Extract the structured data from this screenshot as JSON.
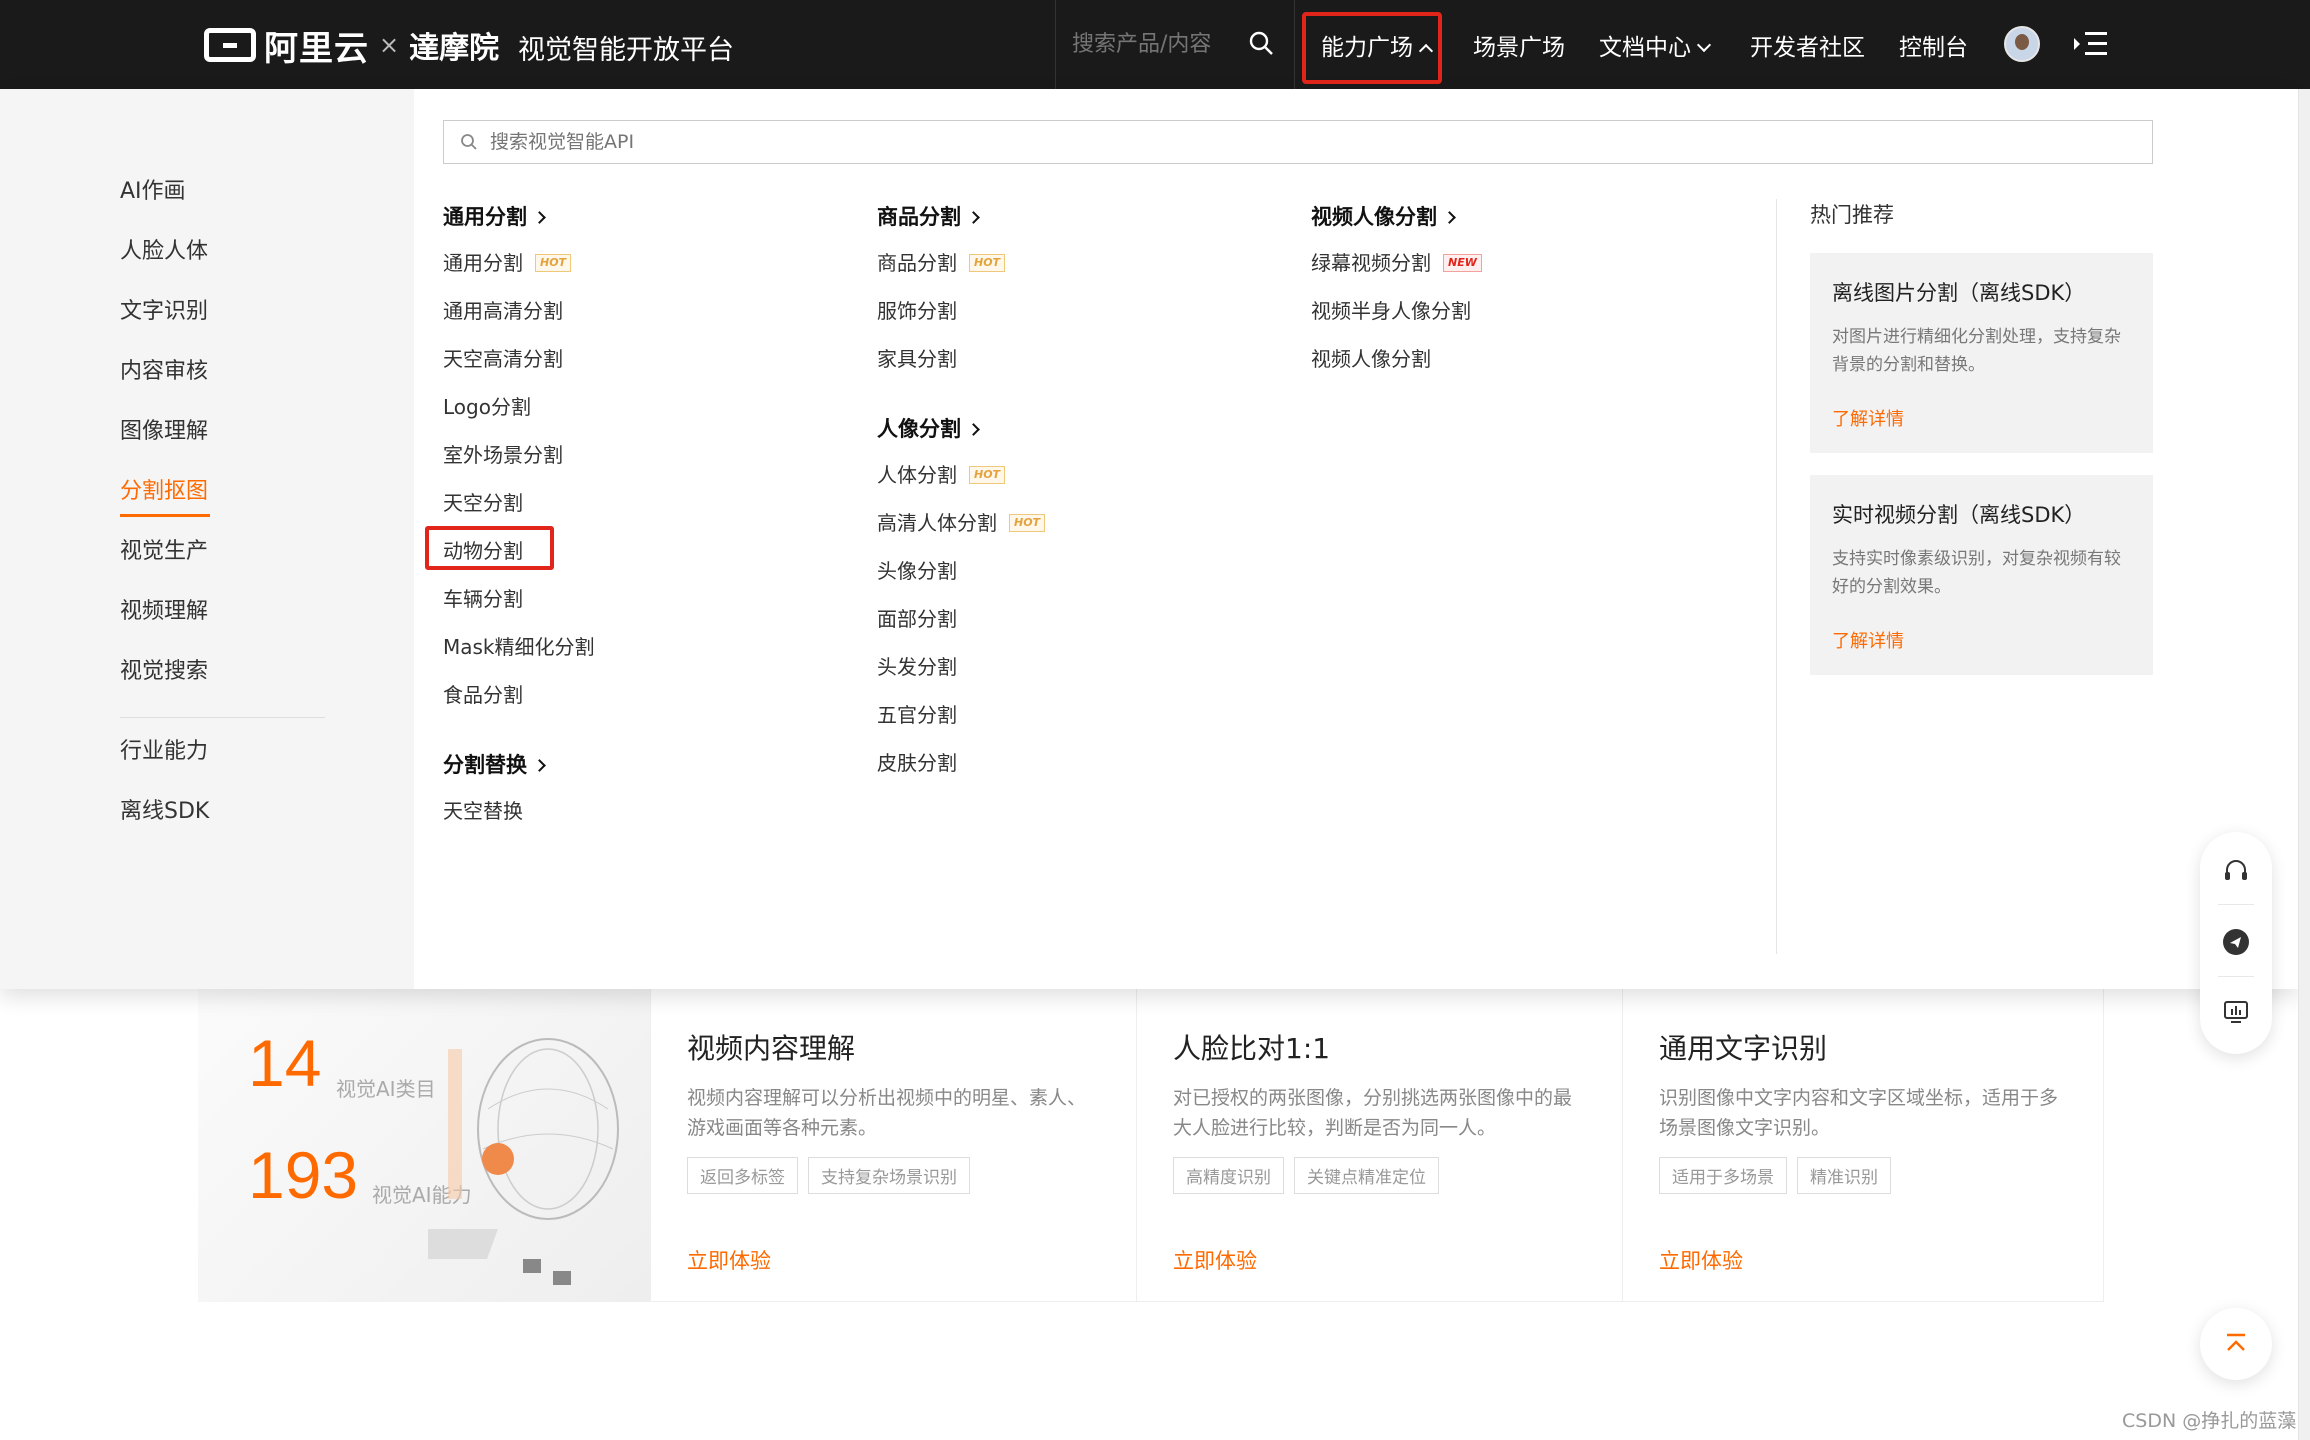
{
  "nav": {
    "logo_text": "阿里云",
    "logo_x": "×",
    "logo_damo": "達摩院",
    "platform_title": "视觉智能开放平台",
    "search_placeholder": "搜索产品/内容",
    "items": [
      "能力广场",
      "场景广场",
      "文档中心",
      "开发者社区",
      "控制台"
    ]
  },
  "sidebar": {
    "items": [
      "AI作画",
      "人脸人体",
      "文字识别",
      "内容审核",
      "图像理解",
      "分割抠图",
      "视觉生产",
      "视频理解",
      "视觉搜索",
      "行业能力",
      "离线SDK"
    ],
    "active": "分割抠图"
  },
  "api_search": {
    "placeholder": "搜索视觉智能API"
  },
  "sections": {
    "general": {
      "title": "通用分割",
      "items": [
        "通用分割",
        "通用高清分割",
        "天空高清分割",
        "Logo分割",
        "室外场景分割",
        "天空分割",
        "动物分割",
        "车辆分割",
        "Mask精细化分割",
        "食品分割"
      ]
    },
    "replace": {
      "title": "分割替换",
      "items": [
        "天空替换"
      ]
    },
    "goods": {
      "title": "商品分割",
      "items": [
        "商品分割",
        "服饰分割",
        "家具分割"
      ]
    },
    "portrait": {
      "title": "人像分割",
      "items": [
        "人体分割",
        "高清人体分割",
        "头像分割",
        "面部分割",
        "头发分割",
        "五官分割",
        "皮肤分割"
      ]
    },
    "video": {
      "title": "视频人像分割",
      "items": [
        "绿幕视频分割",
        "视频半身人像分割",
        "视频人像分割"
      ]
    }
  },
  "badges": {
    "hot": "HOT",
    "new": "NEW"
  },
  "hot": {
    "title": "热门推荐",
    "cards": [
      {
        "title": "离线图片分割（离线SDK）",
        "desc": "对图片进行精细化分割处理，支持复杂背景的分割和替换。",
        "link": "了解详情"
      },
      {
        "title": "实时视频分割（离线SDK）",
        "desc": "支持实时像素级识别，对复杂视频有较好的分割效果。",
        "link": "了解详情"
      }
    ]
  },
  "stats": [
    {
      "num": "14",
      "label": "视觉AI类目"
    },
    {
      "num": "193",
      "label": "视觉AI能力"
    }
  ],
  "products": [
    {
      "title": "视频内容理解",
      "desc": "视频内容理解可以分析出视频中的明星、素人、游戏画面等各种元素。",
      "tags": [
        "返回多标签",
        "支持复杂场景识别"
      ],
      "cta": "立即体验"
    },
    {
      "title": "人脸比对1:1",
      "desc": "对已授权的两张图像，分别挑选两张图像中的最大人脸进行比较，判断是否为同一人。",
      "tags": [
        "高精度识别",
        "关键点精准定位"
      ],
      "cta": "立即体验"
    },
    {
      "title": "通用文字识别",
      "desc": "识别图像中文字内容和文字区域坐标，适用于多场景图像文字识别。",
      "tags": [
        "适用于多场景",
        "精准识别"
      ],
      "cta": "立即体验"
    }
  ],
  "watermark": "CSDN @挣扎的蓝藻",
  "colors": {
    "accent": "#ff6a00",
    "highlight_box": "#e1251b",
    "nav_bg": "#1a1a1a"
  }
}
